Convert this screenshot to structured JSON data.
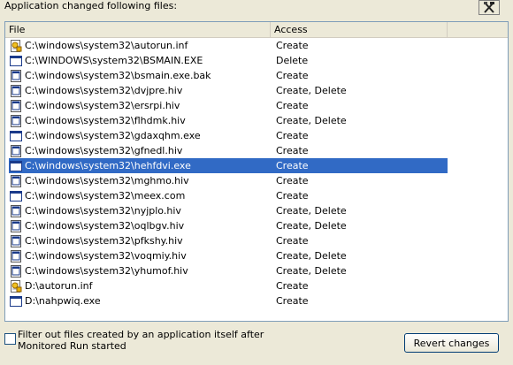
{
  "header": {
    "label": "Application changed following files:"
  },
  "toolbar": {
    "settings_icon": "tools-icon"
  },
  "list": {
    "columns": [
      "File",
      "Access"
    ],
    "rows": [
      {
        "icon": "autorun-inf-icon",
        "path": "C:\\windows\\system32\\autorun.inf",
        "access": "Create"
      },
      {
        "icon": "exe-window-icon",
        "path": "C:\\WINDOWS\\system32\\BSMAIN.EXE",
        "access": "Delete"
      },
      {
        "icon": "file-window-icon",
        "path": "C:\\windows\\system32\\bsmain.exe.bak",
        "access": "Create"
      },
      {
        "icon": "file-window-icon",
        "path": "C:\\windows\\system32\\dvjpre.hiv",
        "access": "Create, Delete"
      },
      {
        "icon": "file-window-icon",
        "path": "C:\\windows\\system32\\ersrpi.hiv",
        "access": "Create"
      },
      {
        "icon": "file-window-icon",
        "path": "C:\\windows\\system32\\flhdmk.hiv",
        "access": "Create, Delete"
      },
      {
        "icon": "exe-window-icon",
        "path": "C:\\windows\\system32\\gdaxqhm.exe",
        "access": "Create"
      },
      {
        "icon": "file-window-icon",
        "path": "C:\\windows\\system32\\gfnedl.hiv",
        "access": "Create"
      },
      {
        "icon": "exe-window-icon",
        "path": "C:\\windows\\system32\\hehfdvi.exe",
        "access": "Create",
        "selected": true
      },
      {
        "icon": "file-window-icon",
        "path": "C:\\windows\\system32\\mghmo.hiv",
        "access": "Create"
      },
      {
        "icon": "exe-window-icon",
        "path": "C:\\windows\\system32\\meex.com",
        "access": "Create"
      },
      {
        "icon": "file-window-icon",
        "path": "C:\\windows\\system32\\nyjplo.hiv",
        "access": "Create, Delete"
      },
      {
        "icon": "file-window-icon",
        "path": "C:\\windows\\system32\\oqlbgv.hiv",
        "access": "Create, Delete"
      },
      {
        "icon": "file-window-icon",
        "path": "C:\\windows\\system32\\pfkshy.hiv",
        "access": "Create"
      },
      {
        "icon": "file-window-icon",
        "path": "C:\\windows\\system32\\voqmiy.hiv",
        "access": "Create, Delete"
      },
      {
        "icon": "file-window-icon",
        "path": "C:\\windows\\system32\\yhumof.hiv",
        "access": "Create, Delete"
      },
      {
        "icon": "autorun-inf-icon",
        "path": "D:\\autorun.inf",
        "access": "Create"
      },
      {
        "icon": "exe-window-icon",
        "path": "D:\\nahpwiq.exe",
        "access": "Create"
      }
    ]
  },
  "footer": {
    "filter_label": "Filter out files created by an application itself after Monitored Run started",
    "filter_checked": false,
    "revert_label": "Revert changes"
  },
  "colors": {
    "selection": "#316ac5",
    "background": "#ece9d8"
  }
}
